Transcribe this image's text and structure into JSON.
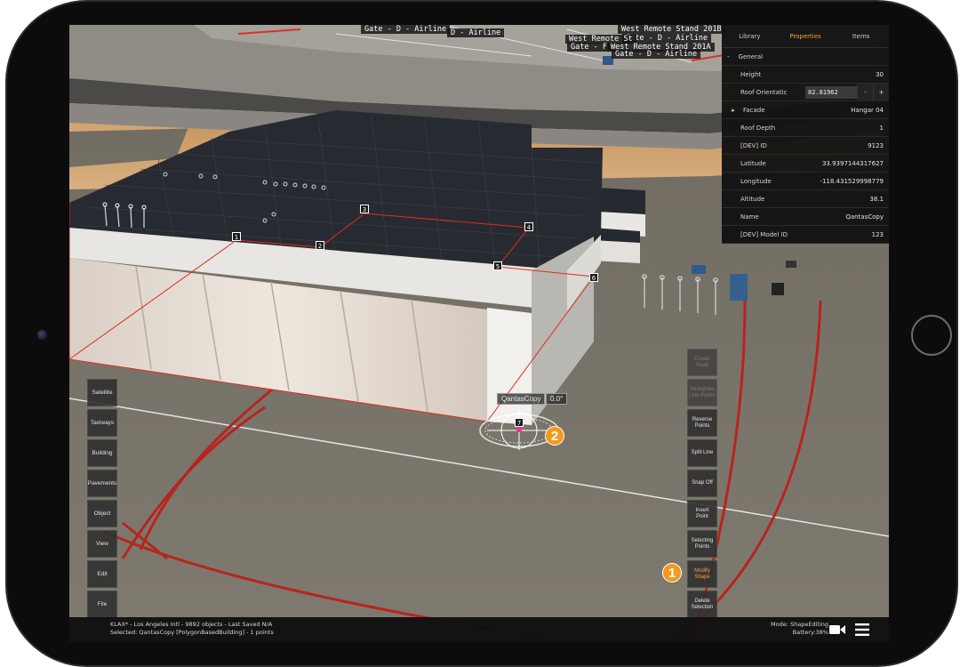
{
  "gate_labels": [
    "Gate - D - Airline",
    "D - Airline",
    "West Remote Stand 201B",
    "Gate - D - Airline",
    "West Remote St",
    "Gate - F",
    "West Remote Stand 201A",
    "Gate - D - Airline"
  ],
  "point_markers": [
    "1",
    "2",
    "3",
    "4",
    "5",
    "6",
    "7"
  ],
  "selection": {
    "name": "QantasCopy",
    "rotation": "0.0°"
  },
  "callouts": [
    "1",
    "2"
  ],
  "panel": {
    "tabs": [
      "Library",
      "Properties",
      "Items"
    ],
    "active_tab": "Properties",
    "section": "General",
    "height_label": "Height",
    "height_value": "30",
    "roof_orientation_label": "Roof Orientatic",
    "roof_orientation_value": "82.81962",
    "minus": "-",
    "plus": "+",
    "facade_label": "Facade",
    "facade_value": "Hangar 04",
    "roof_depth_label": "Roof Depth",
    "roof_depth_value": "1",
    "dev_id_label": "[DEV] ID",
    "dev_id_value": "9123",
    "latitude_label": "Latitude",
    "latitude_value": "33.9397144317627",
    "longitude_label": "Longitude",
    "longitude_value": "-118.431529998779",
    "altitude_label": "Altitude",
    "altitude_value": "38.1",
    "name_label": "Name",
    "name_value": "QantasCopy",
    "model_id_label": "[DEV] Model ID",
    "model_id_value": "123"
  },
  "left_bar": [
    "Satellite",
    "Taxiways",
    "Building",
    "Pavements",
    "Object",
    "View",
    "Edit",
    "File"
  ],
  "tools": [
    {
      "label": "Create Node",
      "state": "disabled"
    },
    {
      "label": "Straighten Line Points",
      "state": "disabled"
    },
    {
      "label": "Reverse Points",
      "state": "normal"
    },
    {
      "label": "Split Line",
      "state": "normal"
    },
    {
      "label": "Snap Off",
      "state": "normal"
    },
    {
      "label": "Insert Point",
      "state": "normal"
    },
    {
      "label": "Selecting Points",
      "state": "normal"
    },
    {
      "label": "Modify Shape",
      "state": "active"
    },
    {
      "label": "Delete Selection",
      "state": "normal"
    }
  ],
  "status": {
    "line1": "KLAX* - Los Angeles Intl - 9892 objects - Last Saved N/A",
    "line2": "Selected: QantasCopy [PolygonBasedBuilding] - 1 points",
    "mode": "Mode: ShapeEditing",
    "battery": "Battery:38%"
  },
  "icons": {
    "camera": "video-camera-icon",
    "menu": "hamburger-menu-icon"
  },
  "colors": {
    "accent": "#f0a531",
    "callout": "#f39a1e",
    "edge_line": "#e02b20"
  }
}
